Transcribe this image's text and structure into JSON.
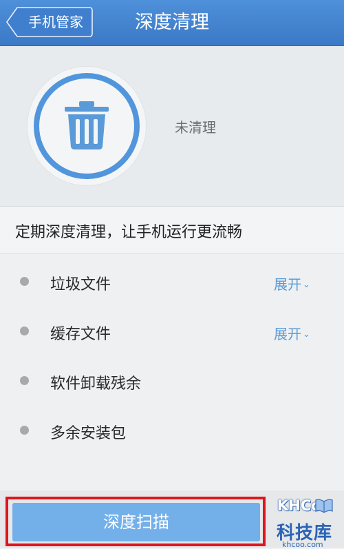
{
  "header": {
    "back_label": "手机管家",
    "title": "深度清理"
  },
  "status": {
    "icon": "trash-icon",
    "text": "未清理"
  },
  "subtitle": "定期深度清理，让手机运行更流畅",
  "items": [
    {
      "label": "垃圾文件",
      "expand": "展开"
    },
    {
      "label": "缓存文件",
      "expand": "展开"
    },
    {
      "label": "软件卸载残余"
    },
    {
      "label": "多余安装包"
    }
  ],
  "scan_button": "深度扫描",
  "watermark": {
    "brand": "KHCoo",
    "name": "科技库",
    "url": "khcoo.com"
  },
  "colors": {
    "header": "#3b79c6",
    "accent": "#5a9ad8",
    "button": "#73b0ea",
    "highlight": "#e0151b"
  }
}
